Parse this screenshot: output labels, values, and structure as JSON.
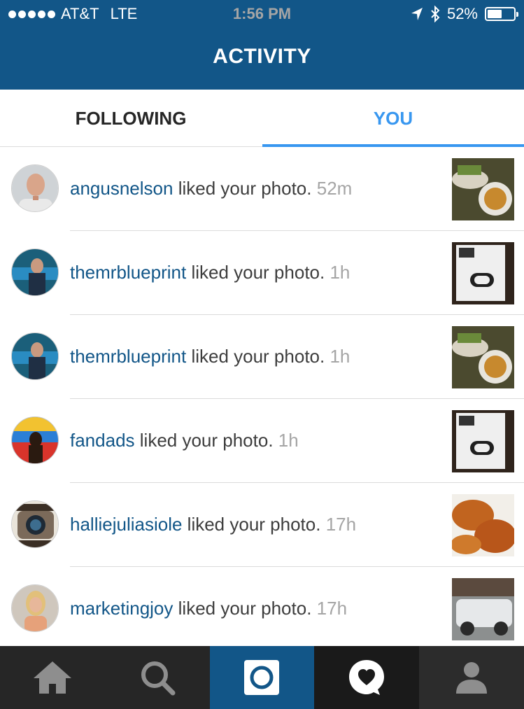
{
  "status_bar": {
    "carrier": "AT&T",
    "network": "LTE",
    "time": "1:56 PM",
    "battery": "52%",
    "battery_level": 0.52
  },
  "nav": {
    "title": "ACTIVITY"
  },
  "tabs": {
    "following": "FOLLOWING",
    "you": "YOU"
  },
  "activity": [
    {
      "username": "angusnelson",
      "action": "liked your photo.",
      "time": "52m",
      "thumb": "food-photo"
    },
    {
      "username": "themrblueprint",
      "action": "liked your photo.",
      "time": "1h",
      "thumb": "up-band-photo"
    },
    {
      "username": "themrblueprint",
      "action": "liked your photo.",
      "time": "1h",
      "thumb": "food-photo"
    },
    {
      "username": "fandads",
      "action": "liked your photo.",
      "time": "1h",
      "thumb": "up-band-photo"
    },
    {
      "username": "halliejuliasiole",
      "action": "liked your photo.",
      "time": "17h",
      "thumb": "fritter-photo"
    },
    {
      "username": "marketingjoy",
      "action": "liked your photo.",
      "time": "17h",
      "thumb": "car-photo"
    }
  ],
  "tabbar": [
    "home-icon",
    "search-icon",
    "camera-icon",
    "activity-heart-icon",
    "profile-icon"
  ],
  "colors": {
    "brand": "#125688",
    "accent": "#3897f0",
    "tabbar": "#262626"
  }
}
